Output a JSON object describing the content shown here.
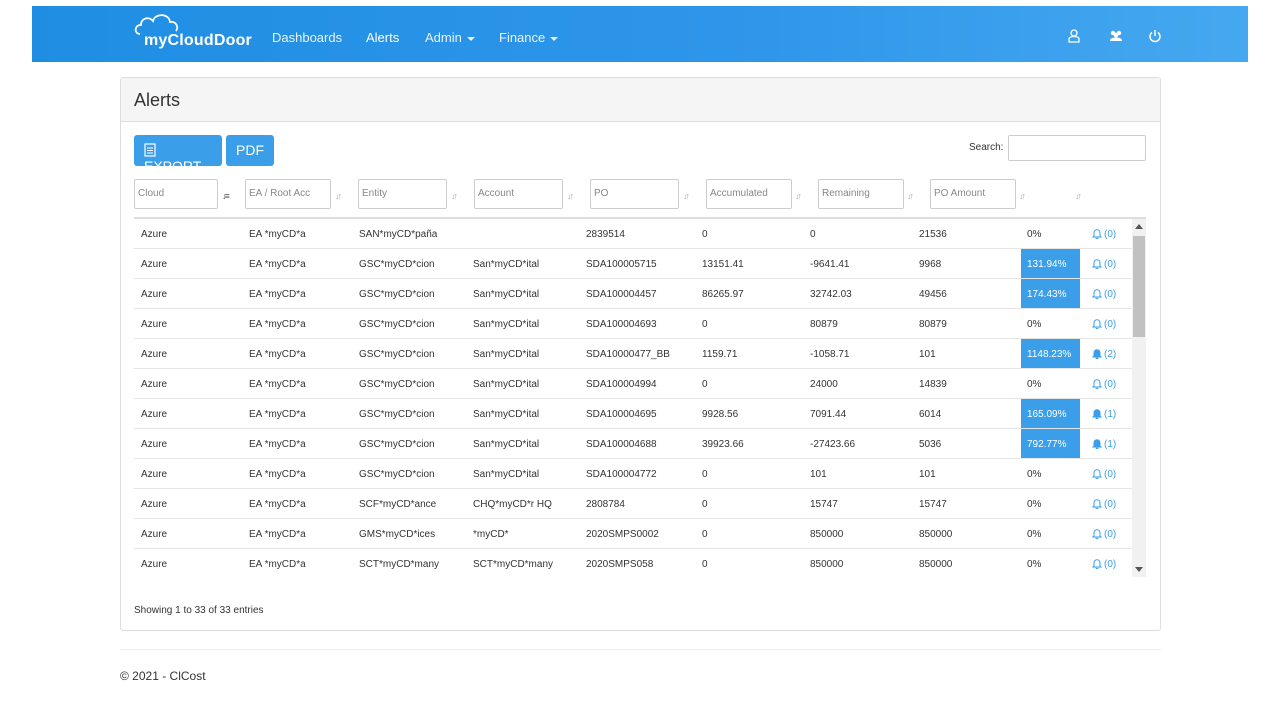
{
  "brand": {
    "name": "myCloudDoor"
  },
  "nav": {
    "dashboards": "Dashboards",
    "alerts": "Alerts",
    "admin": "Admin",
    "finance": "Finance"
  },
  "nav_icons": [
    "user-icon",
    "users-icon",
    "power-icon"
  ],
  "colors": {
    "accent": "#3a9fe8",
    "navbar": "#2f96ea"
  },
  "panel": {
    "title": "Alerts"
  },
  "toolbar": {
    "export_label": "EXPORT",
    "pdf_label": "PDF"
  },
  "search": {
    "label": "Search:",
    "value": ""
  },
  "filters": {
    "cloud": "Cloud",
    "ea": "EA / Root Acc",
    "entity": "Entity",
    "account": "Account",
    "po": "PO",
    "accumulated": "Accumulated",
    "remaining": "Remaining",
    "po_amount": "PO Amount"
  },
  "rows": [
    {
      "cloud": "Azure",
      "ea": "EA *myCD*a",
      "entity": "SAN*myCD*paña",
      "account": "",
      "po": "2839514",
      "accumulated": "0",
      "remaining": "0",
      "po_amount": "21536",
      "pct": "0%",
      "hl": false,
      "alerts": "(0)",
      "filled": false
    },
    {
      "cloud": "Azure",
      "ea": "EA *myCD*a",
      "entity": "GSC*myCD*cion",
      "account": "San*myCD*ital",
      "po": "SDA100005715",
      "accumulated": "13151.41",
      "remaining": "-9641.41",
      "po_amount": "9968",
      "pct": "131.94%",
      "hl": true,
      "alerts": "(0)",
      "filled": false
    },
    {
      "cloud": "Azure",
      "ea": "EA *myCD*a",
      "entity": "GSC*myCD*cion",
      "account": "San*myCD*ital",
      "po": "SDA100004457",
      "accumulated": "86265.97",
      "remaining": "32742.03",
      "po_amount": "49456",
      "pct": "174.43%",
      "hl": true,
      "alerts": "(0)",
      "filled": false
    },
    {
      "cloud": "Azure",
      "ea": "EA *myCD*a",
      "entity": "GSC*myCD*cion",
      "account": "San*myCD*ital",
      "po": "SDA100004693",
      "accumulated": "0",
      "remaining": "80879",
      "po_amount": "80879",
      "pct": "0%",
      "hl": false,
      "alerts": "(0)",
      "filled": false
    },
    {
      "cloud": "Azure",
      "ea": "EA *myCD*a",
      "entity": "GSC*myCD*cion",
      "account": "San*myCD*ital",
      "po": "SDA10000477_BB",
      "accumulated": "1159.71",
      "remaining": "-1058.71",
      "po_amount": "101",
      "pct": "1148.23%",
      "hl": true,
      "alerts": "(2)",
      "filled": true
    },
    {
      "cloud": "Azure",
      "ea": "EA *myCD*a",
      "entity": "GSC*myCD*cion",
      "account": "San*myCD*ital",
      "po": "SDA100004994",
      "accumulated": "0",
      "remaining": "24000",
      "po_amount": "14839",
      "pct": "0%",
      "hl": false,
      "alerts": "(0)",
      "filled": false
    },
    {
      "cloud": "Azure",
      "ea": "EA *myCD*a",
      "entity": "GSC*myCD*cion",
      "account": "San*myCD*ital",
      "po": "SDA100004695",
      "accumulated": "9928.56",
      "remaining": "7091.44",
      "po_amount": "6014",
      "pct": "165.09%",
      "hl": true,
      "alerts": "(1)",
      "filled": true
    },
    {
      "cloud": "Azure",
      "ea": "EA *myCD*a",
      "entity": "GSC*myCD*cion",
      "account": "San*myCD*ital",
      "po": "SDA100004688",
      "accumulated": "39923.66",
      "remaining": "-27423.66",
      "po_amount": "5036",
      "pct": "792.77%",
      "hl": true,
      "alerts": "(1)",
      "filled": true
    },
    {
      "cloud": "Azure",
      "ea": "EA *myCD*a",
      "entity": "GSC*myCD*cion",
      "account": "San*myCD*ital",
      "po": "SDA100004772",
      "accumulated": "0",
      "remaining": "101",
      "po_amount": "101",
      "pct": "0%",
      "hl": false,
      "alerts": "(0)",
      "filled": false
    },
    {
      "cloud": "Azure",
      "ea": "EA *myCD*a",
      "entity": "SCF*myCD*ance",
      "account": "CHQ*myCD*r HQ",
      "po": "2808784",
      "accumulated": "0",
      "remaining": "15747",
      "po_amount": "15747",
      "pct": "0%",
      "hl": false,
      "alerts": "(0)",
      "filled": false
    },
    {
      "cloud": "Azure",
      "ea": "EA *myCD*a",
      "entity": "GMS*myCD*ices",
      "account": "*myCD*",
      "po": "2020SMPS0002",
      "accumulated": "0",
      "remaining": "850000",
      "po_amount": "850000",
      "pct": "0%",
      "hl": false,
      "alerts": "(0)",
      "filled": false
    },
    {
      "cloud": "Azure",
      "ea": "EA *myCD*a",
      "entity": "SCT*myCD*many",
      "account": "SCT*myCD*many",
      "po": "2020SMPS058",
      "accumulated": "0",
      "remaining": "850000",
      "po_amount": "850000",
      "pct": "0%",
      "hl": false,
      "alerts": "(0)",
      "filled": false
    }
  ],
  "table_info": "Showing 1 to 33 of 33 entries",
  "footer": {
    "text": "© 2021 - ClCost"
  }
}
